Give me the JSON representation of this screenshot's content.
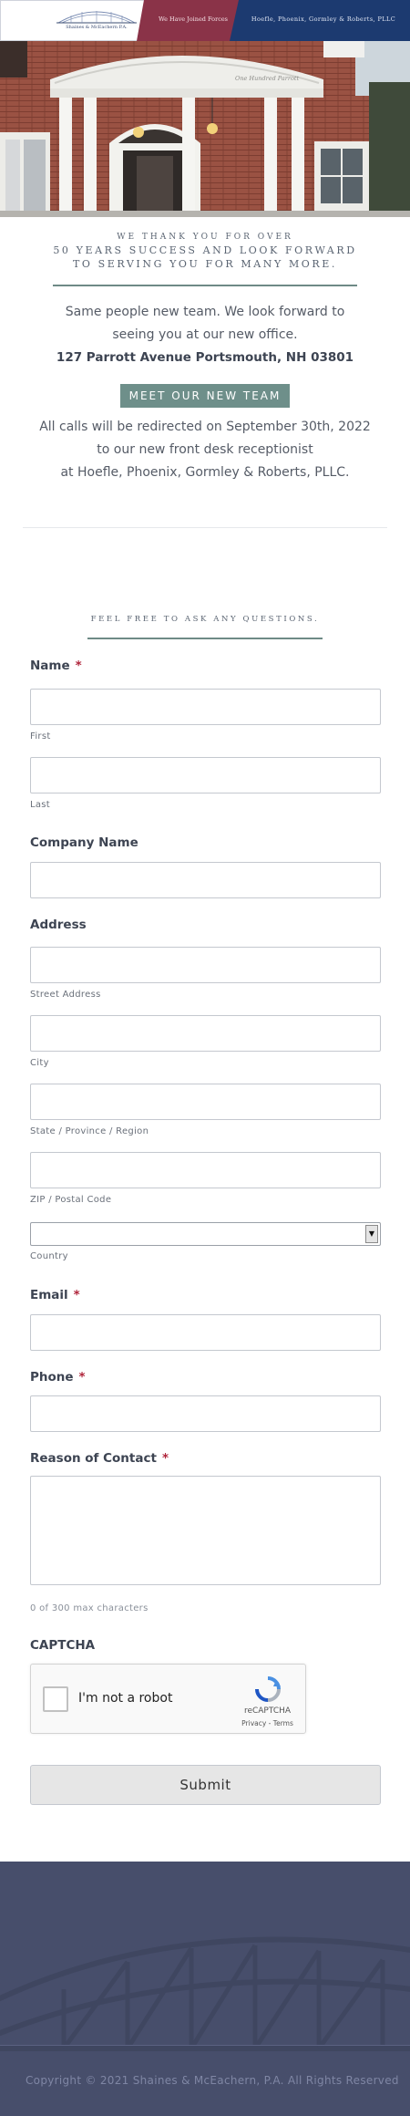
{
  "banner": {
    "logo_name": "Shaines & McEachern P.A.",
    "joined_text": "We Have Joined Forces",
    "new_firm_text": "Hoefle, Phoenix, Gormley & Roberts, PLLC"
  },
  "hero": {
    "sign_text": "One Hundred Parrott"
  },
  "intro": {
    "thanks_line1": "WE THANK YOU FOR OVER",
    "thanks_line2": "50 YEARS SUCCESS AND LOOK FORWARD",
    "thanks_line3": "TO SERVING YOU FOR MANY MORE.",
    "same_people_line1": "Same people new team. We look forward to",
    "same_people_line2": "seeing you at our new office.",
    "address": "127 Parrott Avenue Portsmouth, NH 03801",
    "meet_button": "MEET OUR NEW TEAM",
    "calls_line1": "All calls will be redirected on September 30th, 2022",
    "calls_line2": "to our new front desk receptionist",
    "calls_line3": "at Hoefle, Phoenix, Gormley & Roberts, PLLC."
  },
  "form": {
    "heading": "FEEL FREE TO ASK ANY QUESTIONS.",
    "required_mark": "*",
    "name_label": "Name",
    "first_sublabel": "First",
    "last_sublabel": "Last",
    "company_label": "Company Name",
    "address_label": "Address",
    "street_sublabel": "Street Address",
    "city_sublabel": "City",
    "state_sublabel": "State / Province / Region",
    "zip_sublabel": "ZIP / Postal Code",
    "country_sublabel": "Country",
    "country_value": "",
    "email_label": "Email",
    "phone_label": "Phone",
    "reason_label": "Reason of Contact",
    "char_count": "0 of 300 max characters",
    "captcha_label": "CAPTCHA",
    "captcha_checkbox_text": "I'm not a robot",
    "captcha_brand": "reCAPTCHA",
    "captcha_links": "Privacy - Terms",
    "submit_label": "Submit"
  },
  "footer": {
    "copyright": "Copyright © 2021 Shaines & McEachern, P.A. All Rights Reserved"
  },
  "colors": {
    "banner_red": "#8a3348",
    "banner_blue": "#1c3a70",
    "accent_teal": "#6e8f8a",
    "required_red": "#b0253b",
    "footer_bg": "#474e6b"
  },
  "icons": {
    "logo": "bridge-logo-icon",
    "captcha": "recaptcha-icon",
    "select_arrow": "dropdown-arrow-icon"
  }
}
